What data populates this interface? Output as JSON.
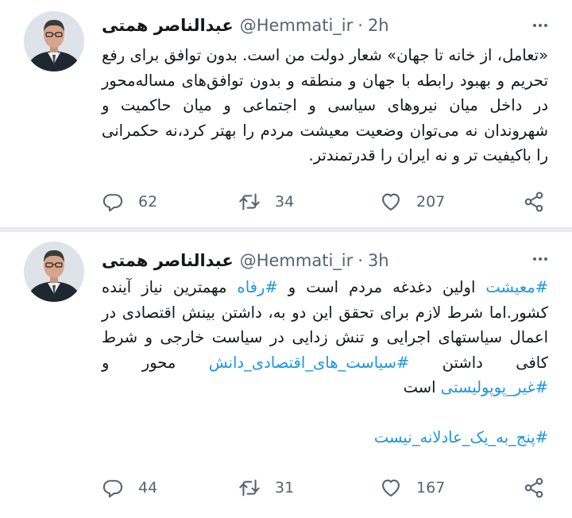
{
  "colors": {
    "hashtag": "#1b95e0",
    "divider": "#e6ecf0",
    "muted": "#536471"
  },
  "icons": {
    "reply": "reply-icon",
    "retweet": "retweet-icon",
    "like": "heart-icon",
    "share": "share-icon",
    "more": "more-icon"
  },
  "tweets": [
    {
      "name": "عبدالناصر همتی",
      "handle": "@Hemmati_ir",
      "separator": "·",
      "time": "2h",
      "text": "«تعامل، از خانه تا جهان» شعار دولت من است. بدون توافق برای رفع تحریم و بهبود رابطه با جهان و منطقه و بدون توافق‌های مساله‌محور در داخل میان نیروهای سیاسی و اجتماعی و میان حاکمیت و شهروندان نه می‌توان وضعیت معیشت مردم را بهتر کرد،نه حکمرانی را باکیفیت تر و نه ایران را قدرتمندتر.",
      "replies": "62",
      "retweets": "34",
      "likes": "207"
    },
    {
      "name": "عبدالناصر همتی",
      "handle": "@Hemmati_ir",
      "separator": "·",
      "time": "3h",
      "text": {
        "h1": "#معیشت",
        "t1": " اولین دغدغه مردم است و ",
        "h2": "#رفاه",
        "t2": " مهمترین نیاز آینده کشور.اما شرط لازم برای تحقق این دو به، داشتن بینش اقتصادی در اعمال سیاستهای اجرایی و تنش زدایی در سیاست خارجی و شرط کافی داشتن ",
        "h3": "#سیاست_های_اقتصادی_دانش",
        "t3": " محور و ",
        "h4": "#غیر_پوپولیستی",
        "t4": " است",
        "h5": "#پنج_به_یک_عادلانه_نیست"
      },
      "replies": "44",
      "retweets": "31",
      "likes": "167"
    }
  ]
}
